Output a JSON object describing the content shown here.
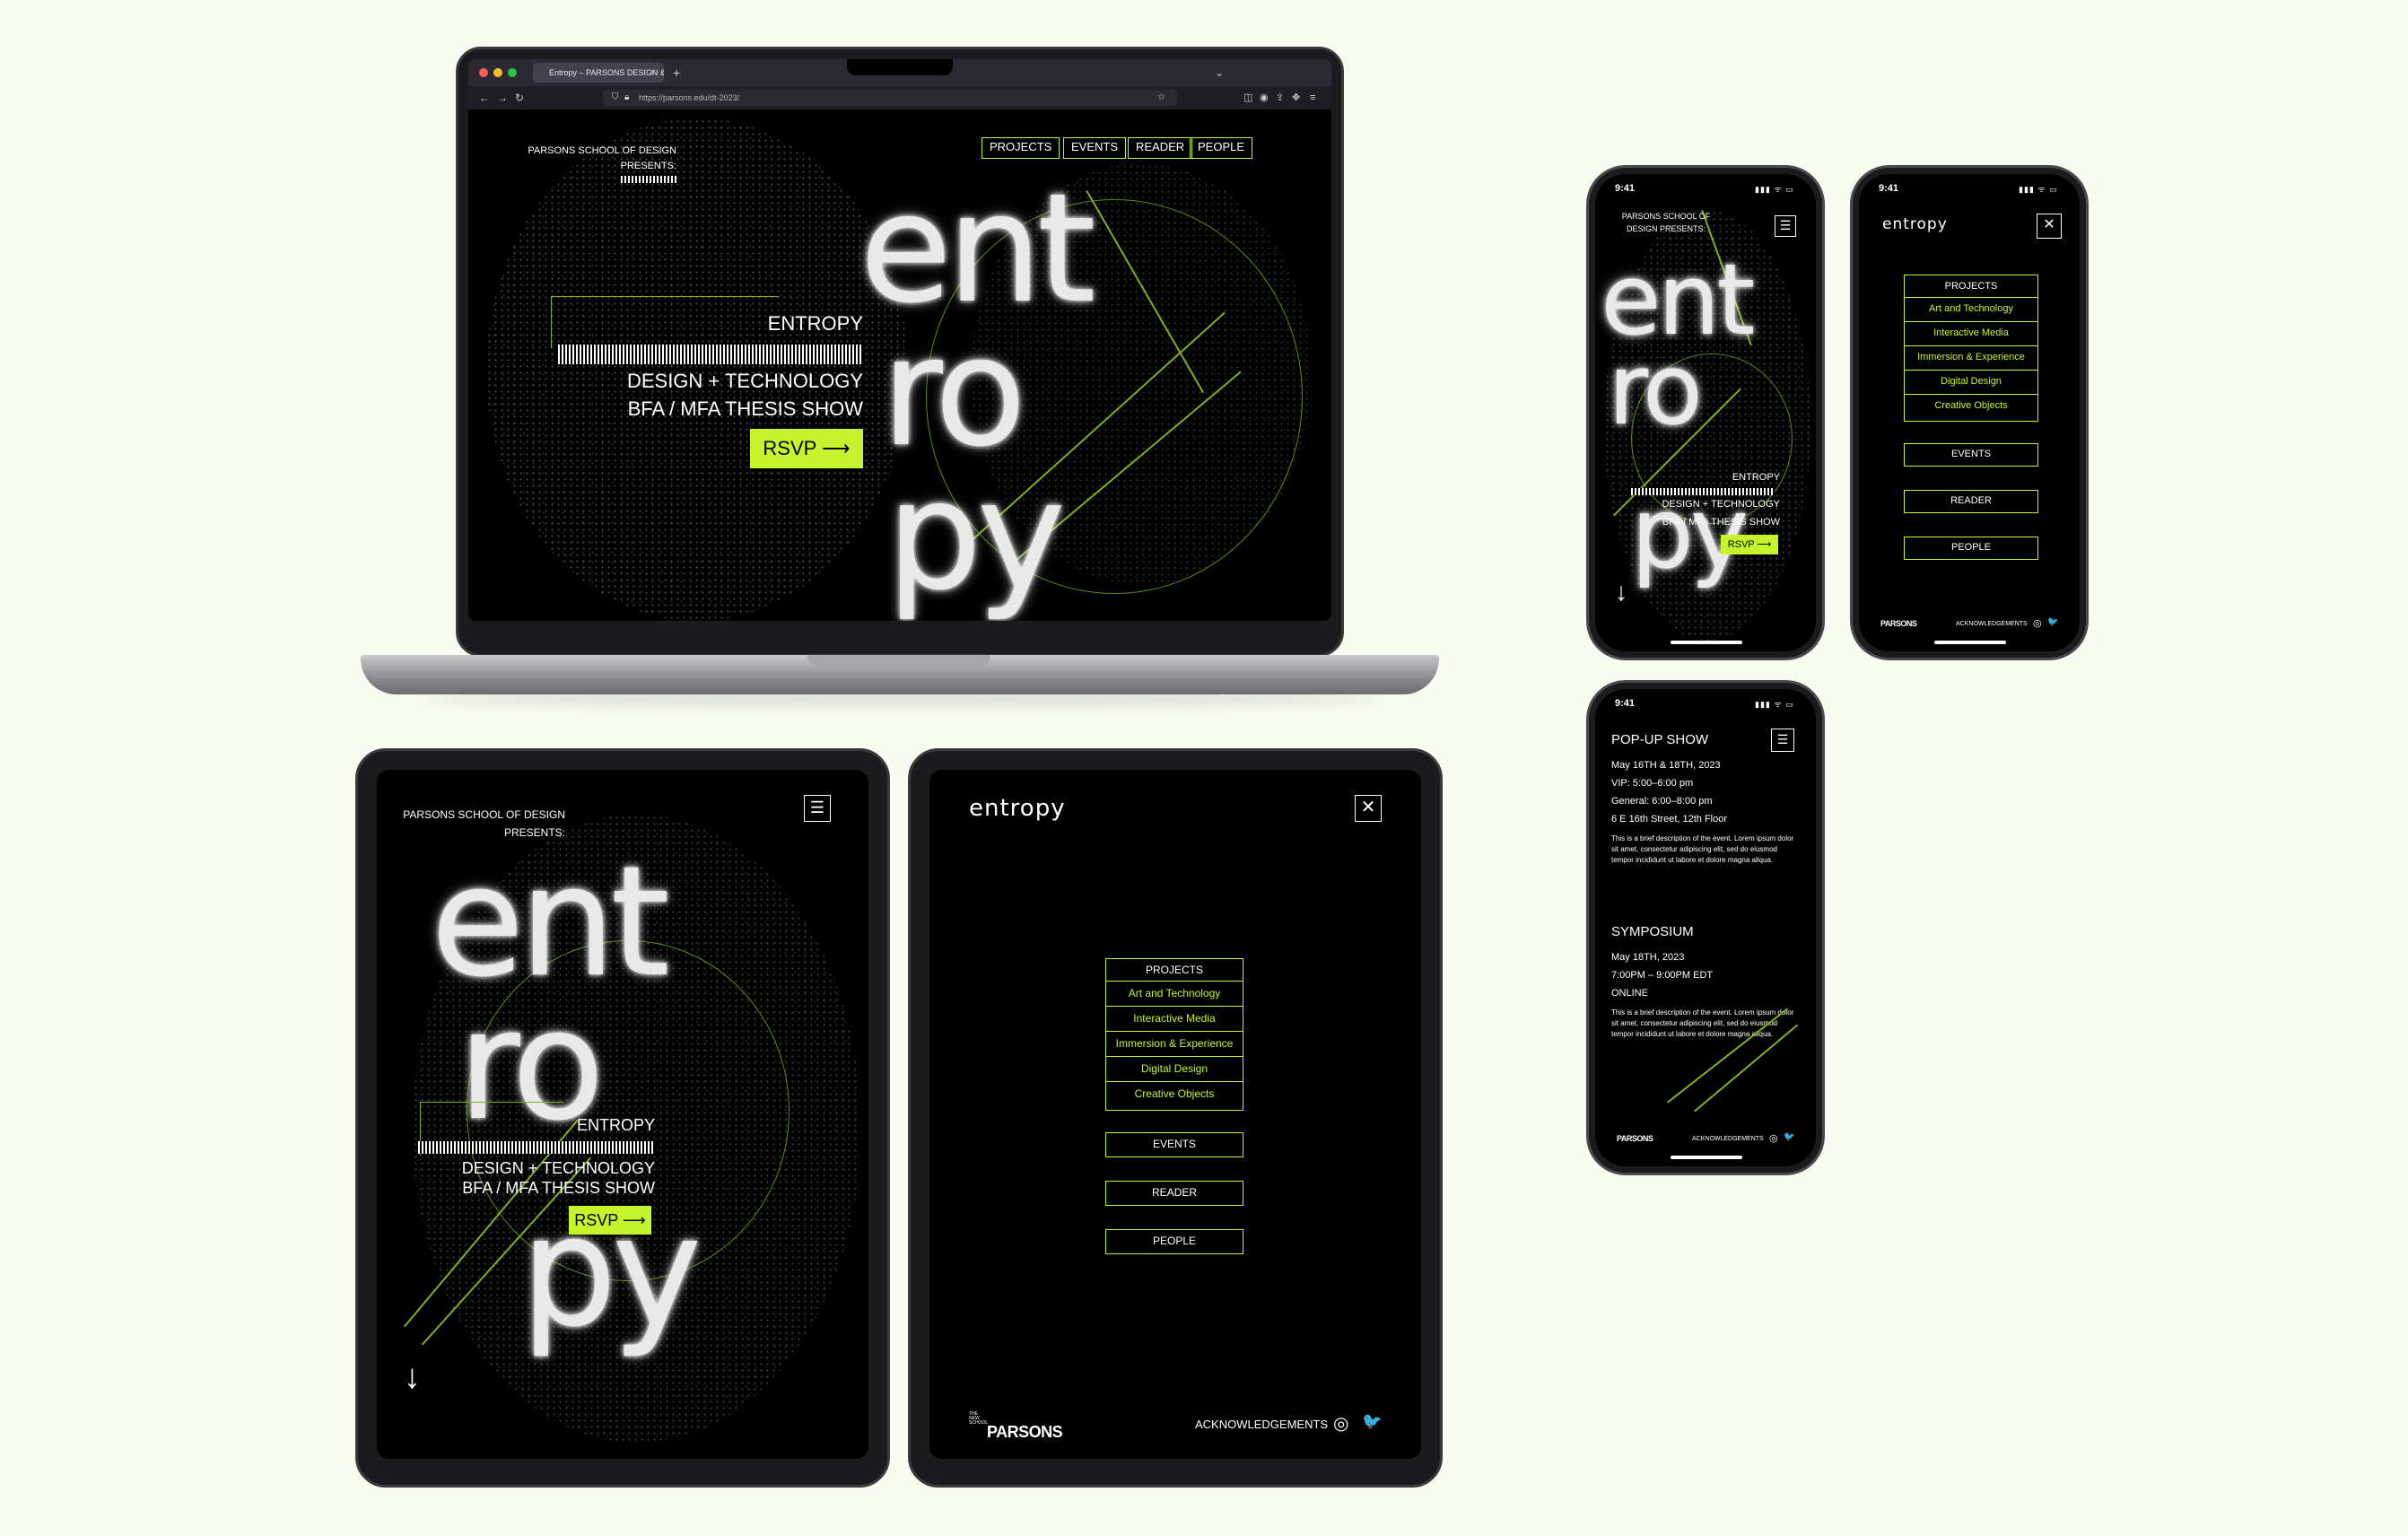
{
  "colors": {
    "accent": "#c4f42c",
    "background": "#f8fbf0",
    "screen": "#000000"
  },
  "browser": {
    "tab_title": "Entropy – PARSONS DESIGN &",
    "tab_close": "×",
    "new_tab": "+",
    "url": "https://parsons.edu/dt-2023/"
  },
  "site": {
    "presenter_line1": "PARSONS SCHOOL OF DESIGN",
    "presenter_line2": "PRESENTS:",
    "nav": [
      "PROJECTS",
      "EVENTS",
      "READER",
      "PEOPLE"
    ],
    "wordmark": "entropy",
    "hero_title": "ENTROPY",
    "hero_line2": "DESIGN + TECHNOLOGY",
    "hero_line3": "BFA / MFA THESIS SHOW",
    "rsvp": "RSVP",
    "arrow_right": "⟶",
    "arrow_down": "↓",
    "hamburger": "☰",
    "close": "✕"
  },
  "mobile_presenter": {
    "line1": "PARSONS SCHOOL OF",
    "line2": "DESIGN PRESENTS:"
  },
  "menu": {
    "projects": "PROJECTS",
    "subitems": [
      "Art and Technology",
      "Interactive Media",
      "Immersion & Experience",
      "Digital Design",
      "Creative Objects"
    ],
    "events": "EVENTS",
    "reader": "READER",
    "people": "PEOPLE"
  },
  "footer": {
    "acknowledgements": "ACKNOWLEDGEMENTS",
    "parsons": "PARSONS",
    "parsons_small": "THE NEW SCHOOL",
    "instagram_glyph": "◎",
    "twitter_glyph": "🐦"
  },
  "phone": {
    "time": "9:41",
    "status": "▮▮▮ ᯤ ▭"
  },
  "events": [
    {
      "title": "POP-UP SHOW",
      "lines": [
        "May 16TH & 18TH, 2023",
        "VIP: 5:00–6:00 pm",
        "General: 6:00–8:00 pm",
        "6 E 16th Street, 12th Floor"
      ],
      "description": "This is a brief description of the event. Lorem ipsum dolor sit amet, consectetur adipiscing elit, sed do eiusmod tempor incididunt ut labore et dolore magna aliqua."
    },
    {
      "title": "SYMPOSIUM",
      "lines": [
        "May 18TH, 2023",
        "7:00PM – 9:00PM EDT",
        "ONLINE"
      ],
      "description": "This is a brief description of the event. Lorem ipsum dolor sit amet, consectetur adipiscing elit, sed do eiusmod tempor incididunt ut labore et dolore magna aliqua."
    }
  ]
}
